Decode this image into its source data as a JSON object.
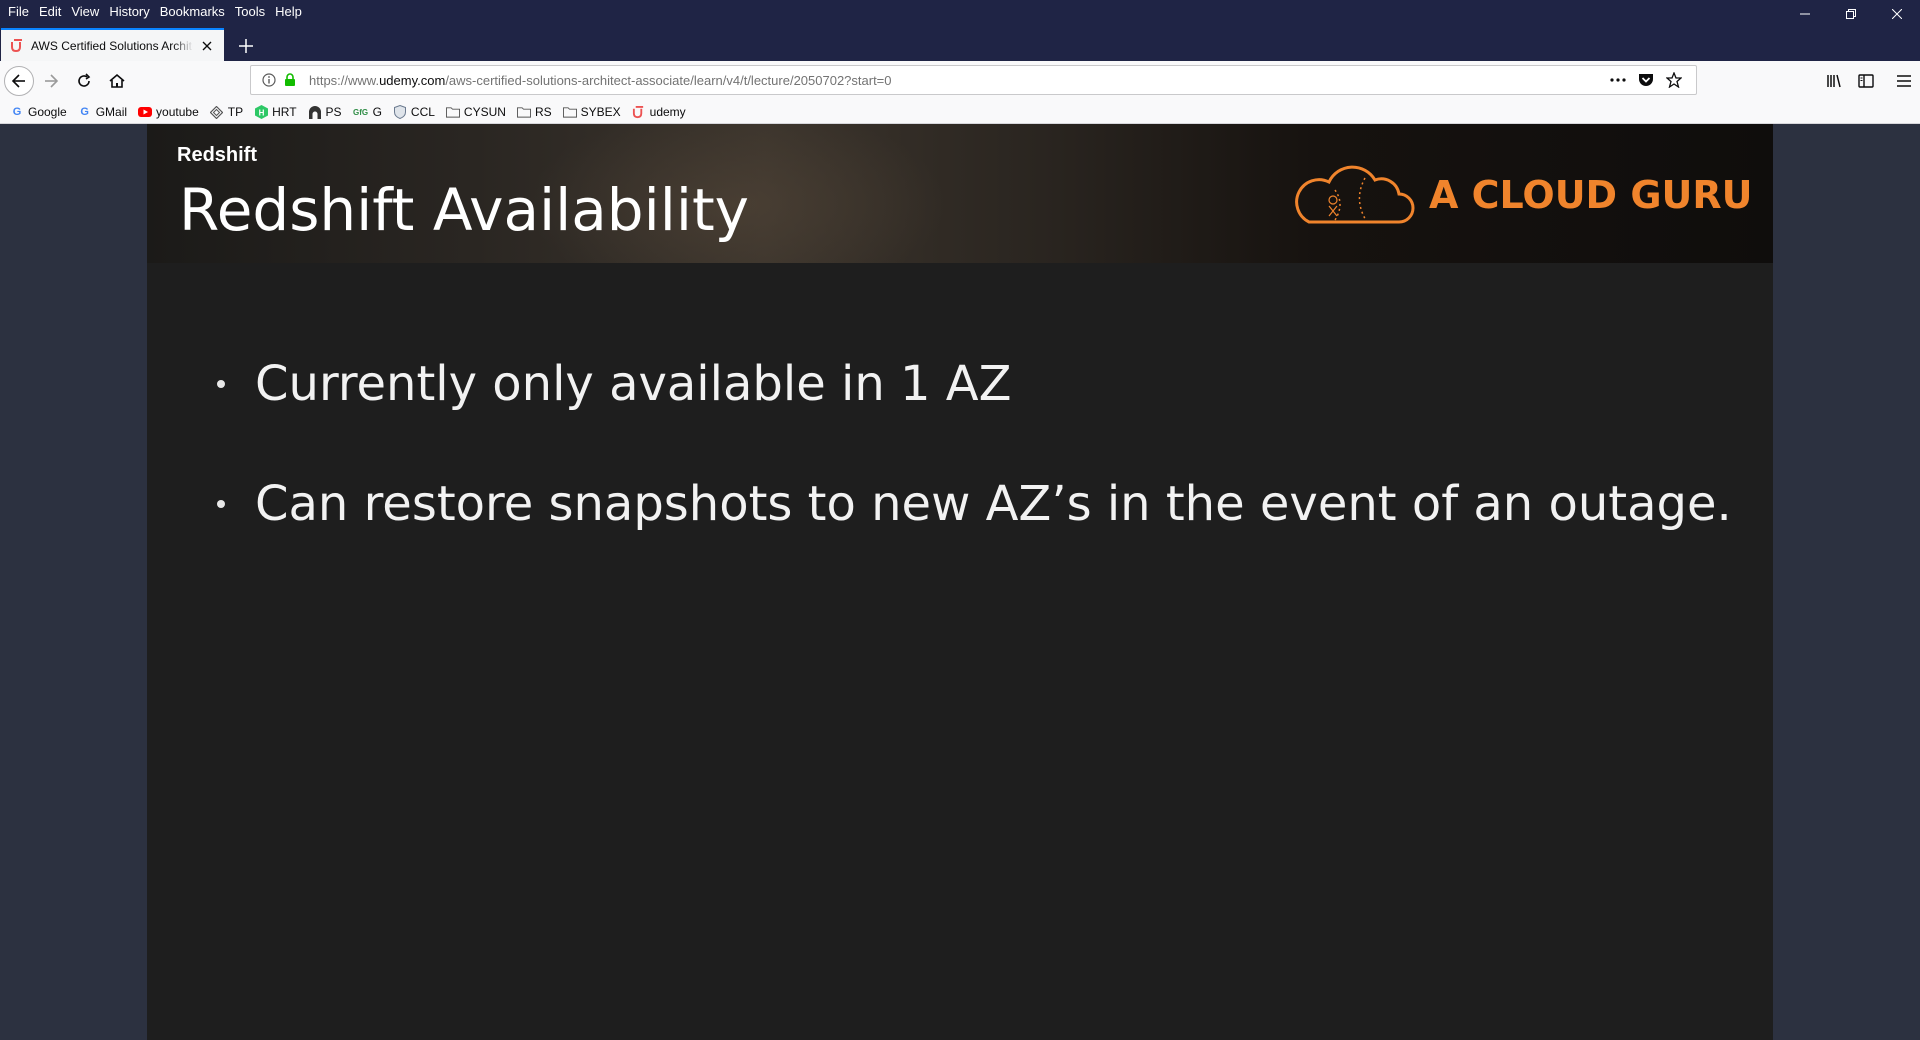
{
  "menubar": {
    "items": [
      "File",
      "Edit",
      "View",
      "History",
      "Bookmarks",
      "Tools",
      "Help"
    ]
  },
  "tab": {
    "title": "AWS Certified Solutions Architect"
  },
  "urlbar": {
    "prefix": "https://www.",
    "domain": "udemy.com",
    "path": "/aws-certified-solutions-architect-associate/learn/v4/t/lecture/2050702?start=0"
  },
  "bookmarks": [
    {
      "label": "Google",
      "icon": "google-icon",
      "color": "#4285f4"
    },
    {
      "label": "GMail",
      "icon": "google-icon",
      "color": "#4285f4"
    },
    {
      "label": "youtube",
      "icon": "youtube-icon",
      "color": "#ff0000"
    },
    {
      "label": "TP",
      "icon": "diamond-icon",
      "color": "#555555"
    },
    {
      "label": "HRT",
      "icon": "hackerrank-icon",
      "color": "#2ec866"
    },
    {
      "label": "PS",
      "icon": "arch-icon",
      "color": "#333333"
    },
    {
      "label": "G",
      "icon": "geeks-icon",
      "color": "#2f8d46"
    },
    {
      "label": "CCL",
      "icon": "shield-icon",
      "color": "#6b7a8f"
    },
    {
      "label": "CYSUN",
      "icon": "folder-icon",
      "color": "#666666"
    },
    {
      "label": "RS",
      "icon": "folder-icon",
      "color": "#666666"
    },
    {
      "label": "SYBEX",
      "icon": "folder-icon",
      "color": "#666666"
    },
    {
      "label": "udemy",
      "icon": "udemy-icon",
      "color": "#ec5252"
    }
  ],
  "slide": {
    "section": "Redshift",
    "title": "Redshift Availability",
    "brand": "A CLOUD GURU",
    "brand_color": "#f0842c",
    "bullets": [
      "Currently only available in 1 AZ",
      "Can restore snapshots to new AZ’s in the event of an outage."
    ]
  }
}
